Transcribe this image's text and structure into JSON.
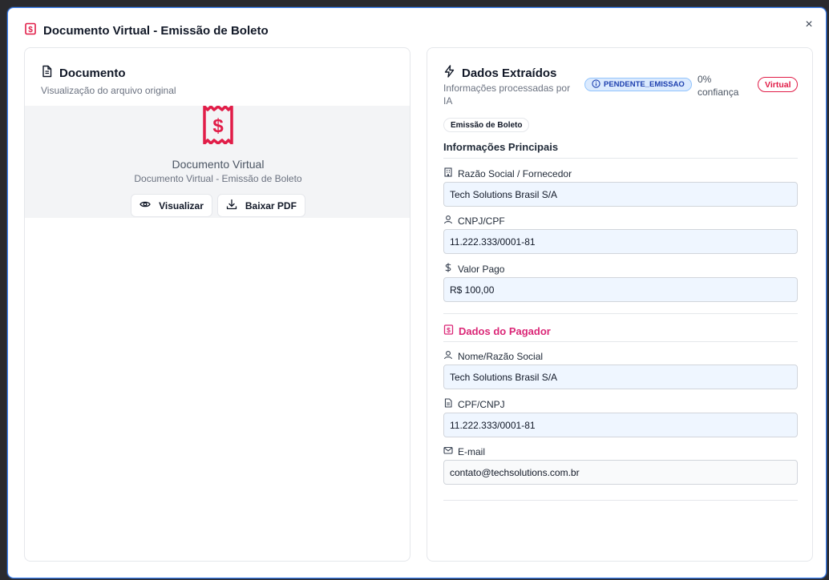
{
  "modal": {
    "title": "Documento Virtual - Emissão de Boleto",
    "close_symbol": "×"
  },
  "document_panel": {
    "title": "Documento",
    "subtitle": "Visualização do arquivo original",
    "preview": {
      "icon": "receipt-dollar-icon",
      "name": "Documento Virtual",
      "description": "Documento Virtual - Emissão de Boleto"
    },
    "actions": {
      "view_label": "Visualizar",
      "download_label": "Baixar PDF"
    }
  },
  "extracted_panel": {
    "title": "Dados Extraídos",
    "subtitle": "Informações processadas por IA",
    "status_badge": "PENDENTE_EMISSAO",
    "confidence": "0% confiança",
    "virtual_badge": "Virtual",
    "type_badge": "Emissão de Boleto",
    "main_section": {
      "title": "Informações Principais",
      "fields": [
        {
          "label": "Razão Social / Fornecedor",
          "value": "Tech Solutions Brasil S/A",
          "icon": "building-icon"
        },
        {
          "label": "CNPJ/CPF",
          "value": "11.222.333/0001-81",
          "icon": "user-icon"
        },
        {
          "label": "Valor Pago",
          "value": "R$ 100,00",
          "icon": "dollar-icon"
        }
      ]
    },
    "payer_section": {
      "title": "Dados do Pagador",
      "fields": [
        {
          "label": "Nome/Razão Social",
          "value": "Tech Solutions Brasil S/A",
          "icon": "user-icon"
        },
        {
          "label": "CPF/CNPJ",
          "value": "11.222.333/0001-81",
          "icon": "document-icon"
        },
        {
          "label": "E-mail",
          "value": "contato@techsolutions.com.br",
          "icon": "mail-icon"
        }
      ]
    }
  },
  "colors": {
    "accent": "#e11d48",
    "pink": "#db2777",
    "status_bg": "#dbeafe",
    "status_text": "#1e40af",
    "field_bg": "#eff6ff"
  }
}
